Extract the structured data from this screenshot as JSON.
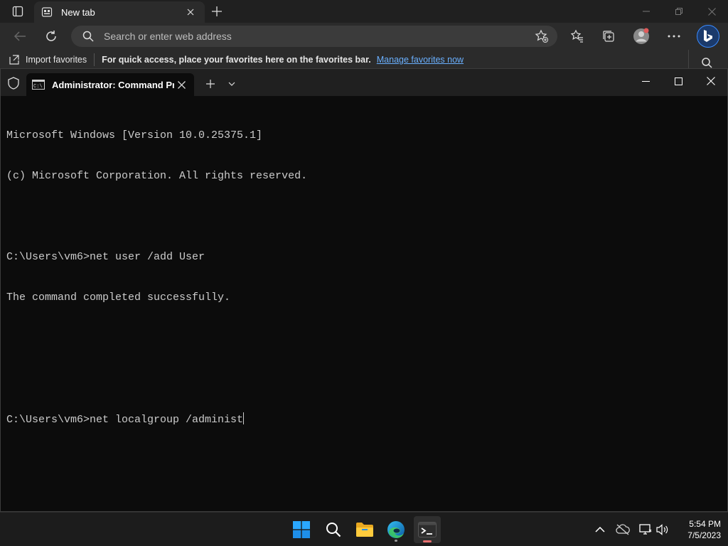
{
  "browser": {
    "tab_title": "New tab",
    "address_placeholder": "Search or enter web address",
    "favorites_bar": {
      "import_label": "Import favorites",
      "message": "For quick access, place your favorites here on the favorites bar.",
      "link": "Manage favorites now"
    }
  },
  "terminal": {
    "tab_title": "Administrator:  Command Prc",
    "lines": [
      "Microsoft Windows [Version 10.0.25375.1]",
      "(c) Microsoft Corporation. All rights reserved.",
      "",
      "C:\\Users\\vm6>net user /add User",
      "The command completed successfully.",
      "",
      ""
    ],
    "prompt_line": "C:\\Users\\vm6>net localgroup /administ"
  },
  "taskbar": {
    "apps": [
      "start-icon",
      "search-icon",
      "file-explorer-icon",
      "edge-icon",
      "terminal-icon"
    ],
    "time": "5:54 PM",
    "date": "7/5/2023"
  },
  "colors": {
    "terminal_bg": "#0c0c0c",
    "terminal_text": "#cccccc",
    "link": "#6ab0ff",
    "windows_blue": "#2aa7ff"
  }
}
